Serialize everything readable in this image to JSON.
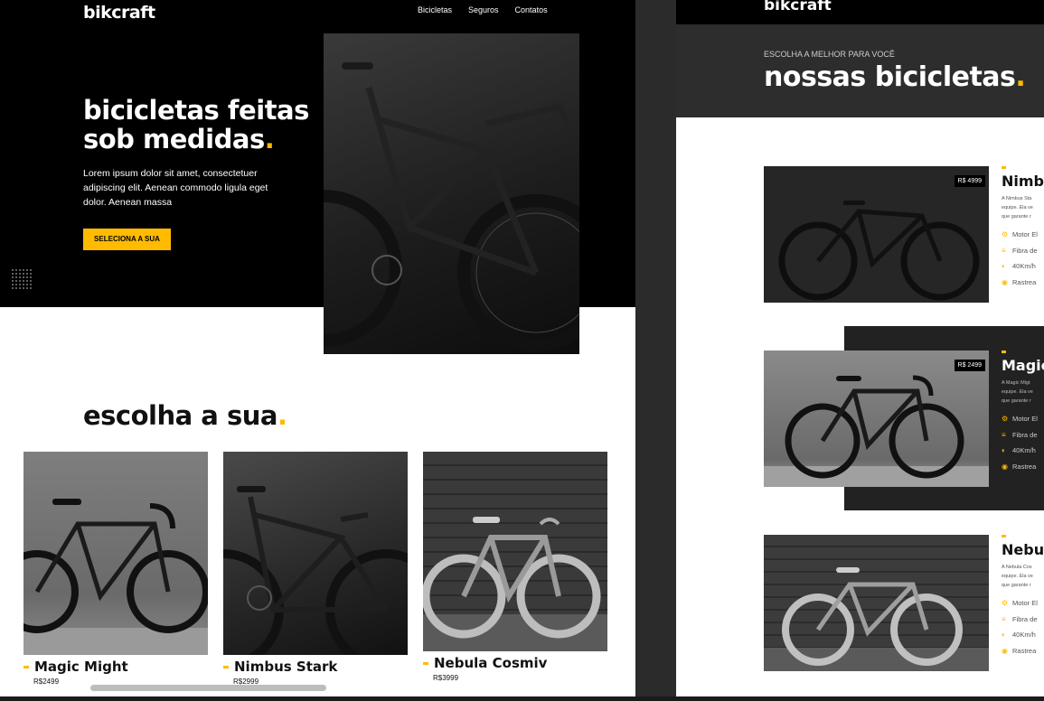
{
  "left": {
    "brand": "bikcraft",
    "nav": [
      "Bicicletas",
      "Seguros",
      "Contatos"
    ],
    "hero": {
      "title_line1": "bicicletas feitas",
      "title_line2": "sob medidas",
      "title_dot": ".",
      "text": "Lorem ipsum dolor sit amet, consectetuer adipiscing elit. Aenean commodo ligula eget dolor. Aenean massa",
      "cta": "SELECIONA A SUA"
    },
    "section": {
      "title": "escolha a sua",
      "dot": "."
    },
    "cards": [
      {
        "name": "Magic Might",
        "price": "R$2499"
      },
      {
        "name": "Nimbus Stark",
        "price": "R$2999"
      },
      {
        "name": "Nebula Cosmiv",
        "price": "R$3999"
      }
    ]
  },
  "right": {
    "brand": "bikcraft",
    "subtitle": "ESCOLHA A MELHOR PARA VOCÊ",
    "title": "nossas bicicletas",
    "dot": ".",
    "products": [
      {
        "price": "R$ 4999",
        "name": "Nimb",
        "desc": [
          "A Nimbus Sta",
          "equipe. Ela ve",
          "que garante r"
        ],
        "features": [
          "Motor El",
          "Fibra de",
          "40Km/h",
          "Rastrea"
        ]
      },
      {
        "price": "R$ 2499",
        "name": "Magic",
        "desc": [
          "A Magic Migt",
          "equipe. Ela ve",
          "que garante r"
        ],
        "features": [
          "Motor El",
          "Fibra de",
          "40Km/h",
          "Rastrea"
        ]
      },
      {
        "price": "",
        "name": "Nebul",
        "desc": [
          "A Nebula Cos",
          "equipe. Ela ve",
          "que garante r"
        ],
        "features": [
          "Motor El",
          "Fibra de",
          "40Km/h",
          "Rastrea"
        ]
      }
    ]
  },
  "icons": [
    "bike-icon",
    "layers-icon",
    "speed-icon",
    "location-icon"
  ],
  "colors": {
    "accent": "#ffbb00",
    "dark": "#000000",
    "panel": "#2d2d2d"
  }
}
